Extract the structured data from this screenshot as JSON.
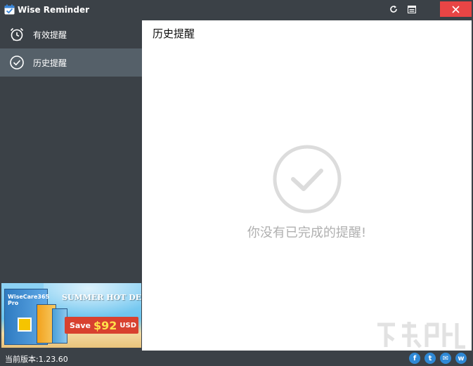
{
  "window": {
    "title": "Wise Reminder",
    "icons": [
      "calendar-check-icon",
      "refresh-icon",
      "menu-icon",
      "close-icon"
    ]
  },
  "sidebar": {
    "items": [
      {
        "label": "有效提醒",
        "icon": "alarm-clock-icon",
        "active": false
      },
      {
        "label": "历史提醒",
        "icon": "check-circle-icon",
        "active": true
      }
    ]
  },
  "banner": {
    "product": "WiseCare365 Pro",
    "headline": "SUMMER HOT DEAL",
    "save_word": "Save",
    "save_amount": "$92",
    "save_unit": "USD"
  },
  "main": {
    "title": "历史提醒",
    "empty_message": "你没有已完成的提醒!"
  },
  "statusbar": {
    "version": "当前版本:1.23.60",
    "social": [
      {
        "glyph": "f",
        "icon": "facebook-icon"
      },
      {
        "glyph": "t",
        "icon": "twitter-icon"
      },
      {
        "glyph": "✉",
        "icon": "mail-icon"
      },
      {
        "glyph": "w",
        "icon": "website-icon"
      }
    ]
  },
  "colors": {
    "chrome": "#3b4147",
    "active_item": "#556069",
    "close": "#e84545",
    "content_bg": "#ffffff",
    "empty_gray": "#b0b0b0",
    "accent_blue": "#2f89d6"
  }
}
